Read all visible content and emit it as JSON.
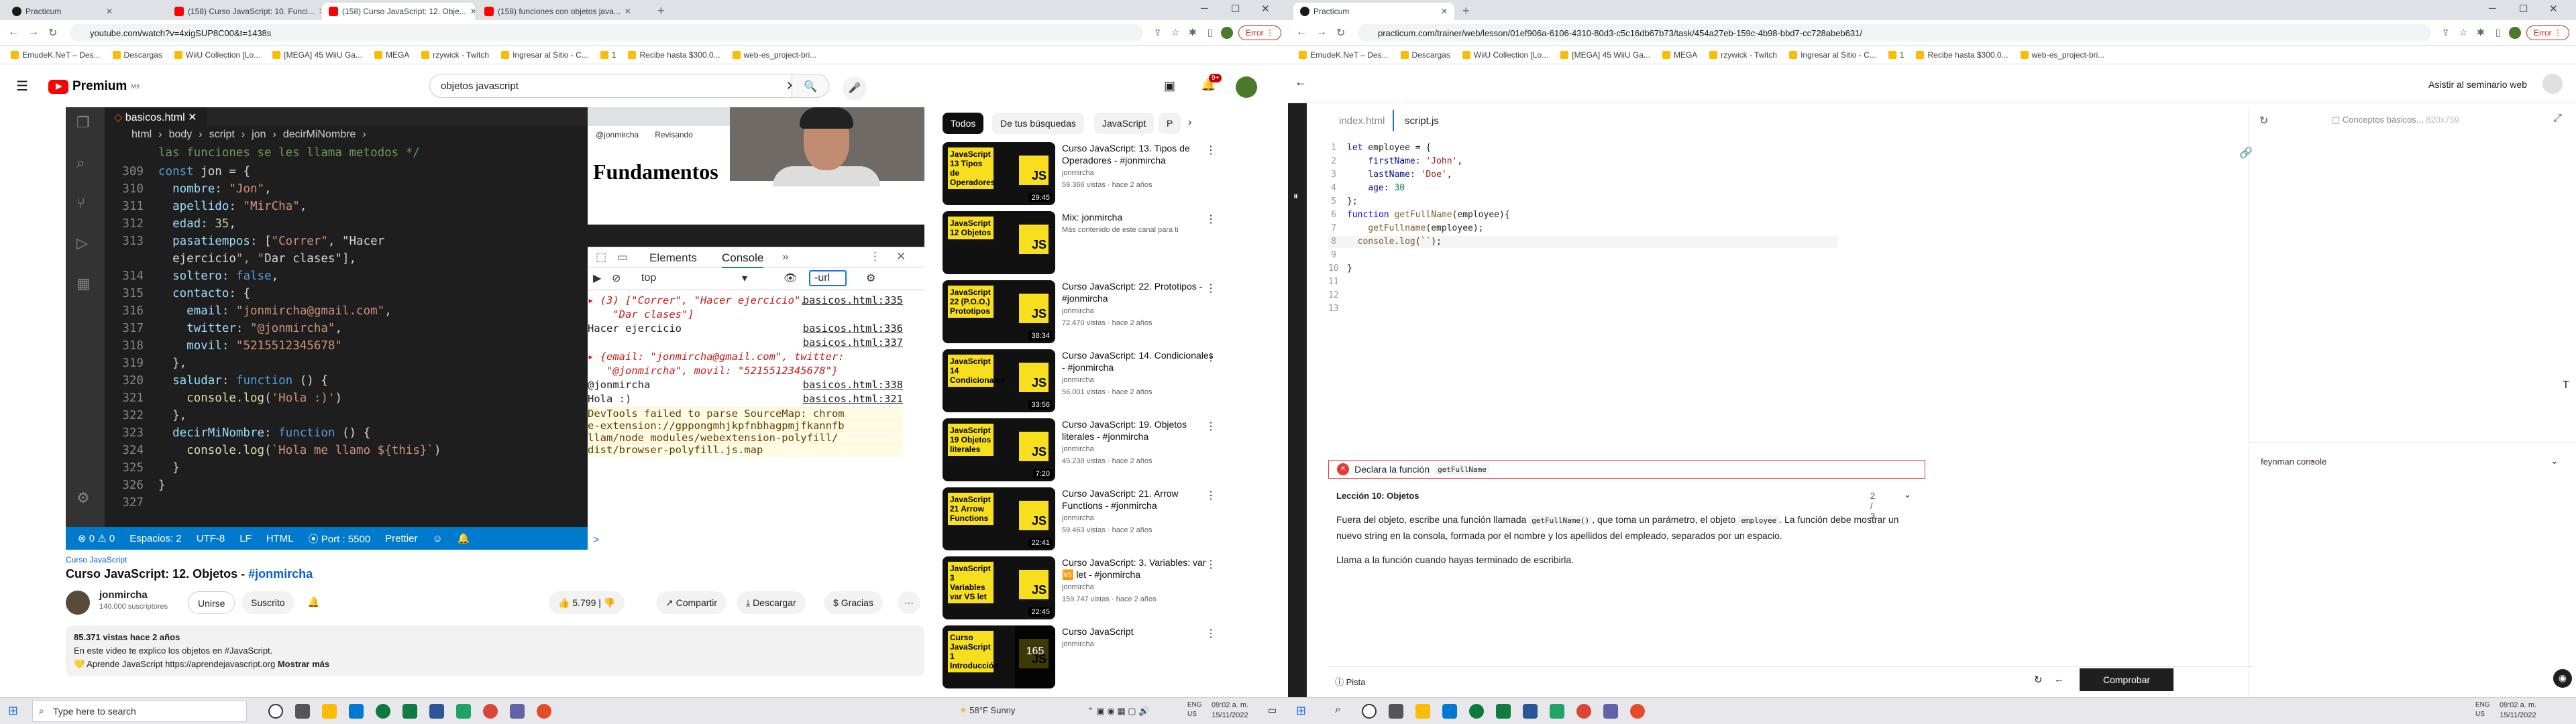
{
  "left_browser": {
    "tabs": [
      {
        "title": "Practicum",
        "active": false
      },
      {
        "title": "(158) Curso JavaScript: 10. Funci...",
        "active": false
      },
      {
        "title": "(158) Curso JavaScript: 12. Obje...",
        "active": true
      },
      {
        "title": "(158) funciones con objetos java...",
        "active": false
      }
    ],
    "url": "youtube.com/watch?v=4xigSUP8C00&t=1438s",
    "error_label": "Error",
    "bookmarks": [
      "EmudeK.NeT – Des...",
      "Descargas",
      "WiiU Collection [Lo...",
      "[MEGA] 45 WiiU Ga...",
      "MEGA",
      "rzywick - Twitch",
      "Ingresar al Sitio - C...",
      "1",
      "Recibe hasta $300.0...",
      "web-es_project-bri..."
    ]
  },
  "youtube": {
    "logo": "Premium",
    "logo_country": "MX",
    "search_value": "objetos javascript",
    "notification_count": "9+",
    "video": {
      "vscode": {
        "tab": "basicos.html",
        "breadcrumb": [
          "html",
          "body",
          "script",
          "jon",
          "decirMiNombre"
        ],
        "comment": "las funciones se les llama metodos */",
        "lines": [
          {
            "n": "309",
            "t": "const jon = {"
          },
          {
            "n": "310",
            "t": "  nombre: \"Jon\","
          },
          {
            "n": "311",
            "t": "  apellido: \"MirCha\","
          },
          {
            "n": "312",
            "t": "  edad: 35,"
          },
          {
            "n": "313",
            "t": "  pasatiempos: [\"Correr\", \"Hacer"
          },
          {
            "n": "",
            "t": "  ejercicio\", \"Dar clases\"],"
          },
          {
            "n": "314",
            "t": "  soltero: false,"
          },
          {
            "n": "315",
            "t": "  contacto: {"
          },
          {
            "n": "316",
            "t": "    email: \"jonmircha@gmail.com\","
          },
          {
            "n": "317",
            "t": "    twitter: \"@jonmircha\","
          },
          {
            "n": "318",
            "t": "    movil: \"5215512345678\""
          },
          {
            "n": "319",
            "t": "  },"
          },
          {
            "n": "320",
            "t": "  saludar: function () {"
          },
          {
            "n": "321",
            "t": "    console.log('Hola :)')"
          },
          {
            "n": "322",
            "t": "  },"
          },
          {
            "n": "323",
            "t": "  decirMiNombre: function () {"
          },
          {
            "n": "324",
            "t": "    console.log(`Hola me llamo ${this}`)"
          },
          {
            "n": "325",
            "t": "  }"
          },
          {
            "n": "326",
            "t": "}"
          },
          {
            "n": "327",
            "t": ""
          }
        ],
        "status": [
          "⊗ 0 ⚠ 0",
          "Espacios: 2",
          "UTF-8",
          "LF",
          "HTML",
          "⦿ Port : 5500",
          "Prettier"
        ]
      },
      "page_heading": "Fundamentos",
      "page_bookmarks": [
        "@jonmircha",
        "Revisando"
      ],
      "devtools": {
        "tabs": [
          "Elements",
          "Console"
        ],
        "context": "top",
        "filter": "-url",
        "rows": [
          {
            "text": "▸ (3) [\"Correr\", \"Hacer ejercicio\",",
            "src": "basicos.html:335",
            "style": "arr"
          },
          {
            "text": "    \"Dar clases\"]",
            "src": "",
            "style": "arr"
          },
          {
            "text": "Hacer ejercicio",
            "src": "basicos.html:336",
            "style": "plain"
          },
          {
            "text": "",
            "src": "basicos.html:337",
            "style": "plain"
          },
          {
            "text": "▸ {email: \"jonmircha@gmail.com\", twitter:",
            "src": "",
            "style": "obj"
          },
          {
            "text": "   \"@jonmircha\", movil: \"5215512345678\"}",
            "src": "",
            "style": "obj"
          },
          {
            "text": "@jonmircha",
            "src": "basicos.html:338",
            "style": "plain"
          },
          {
            "text": "Hola :)",
            "src": "basicos.html:321",
            "style": "plain"
          },
          {
            "text": "DevTools failed to parse SourceMap: chrom",
            "src": "",
            "style": "warn"
          },
          {
            "text": "e-extension://gppongmhjkpfnbhagpmjfkannfb",
            "src": "",
            "style": "warn"
          },
          {
            "text": "llam/node_modules/webextension-polyfill/",
            "src": "",
            "style": "warn"
          },
          {
            "text": "dist/browser-polyfill.js.map",
            "src": "",
            "style": "warn"
          }
        ],
        "prompt": ">"
      }
    },
    "channel_link": "Curso JavaScript",
    "title": "Curso JavaScript: 12. Objetos - #jonmircha",
    "channel": {
      "name": "jonmircha",
      "subs": "140.000 suscriptores",
      "join": "Unirse",
      "subscribe": "Suscrito"
    },
    "actions": {
      "likes": "5.799",
      "share": "Compartir",
      "download": "Descargar",
      "thanks": "Gracias"
    },
    "description": {
      "stats": "85.371 vistas  hace 2 años",
      "line1": "En este video te explico los objetos en #JavaScript.",
      "line2": "💛 Aprende JavaScript https://aprendejavascript.org",
      "more": "Mostrar más"
    },
    "chips": [
      "Todos",
      "De tus búsquedas",
      "JavaScript",
      "P"
    ],
    "recommended": [
      {
        "title": "Curso JavaScript: 13. Tipos de Operadores - #jonmircha",
        "channel": "jonmircha",
        "meta": "59.366 vistas · hace 2 años",
        "dur": "29:45",
        "thumb": "JavaScript 13 Tipos de Operadores"
      },
      {
        "title": "Mix: jonmircha",
        "channel": "Más contenido de este canal para ti",
        "meta": "",
        "dur": "",
        "thumb": "JavaScript 12 Objetos"
      },
      {
        "title": "Curso JavaScript: 22. Prototipos - #jonmircha",
        "channel": "jonmircha",
        "meta": "72.470 vistas · hace 2 años",
        "dur": "38:34",
        "thumb": "JavaScript 22 (P.O.O.) Prototipos"
      },
      {
        "title": "Curso JavaScript: 14. Condicionales - #jonmircha",
        "channel": "jonmircha",
        "meta": "56.001 vistas · hace 2 años",
        "dur": "33:56",
        "thumb": "JavaScript 14 Condicionales"
      },
      {
        "title": "Curso JavaScript: 19. Objetos literales - #jonmircha",
        "channel": "jonmircha",
        "meta": "45.238 vistas · hace 2 años",
        "dur": "7:20",
        "thumb": "JavaScript 19 Objetos literales"
      },
      {
        "title": "Curso JavaScript: 21. Arrow Functions - #jonmircha",
        "channel": "jonmircha",
        "meta": "59.463 vistas · hace 2 años",
        "dur": "22:41",
        "thumb": "JavaScript 21 Arrow Functions"
      },
      {
        "title": "Curso JavaScript: 3. Variables: var 🆚 let - #jonmircha",
        "channel": "jonmircha",
        "meta": "159.747 vistas · hace 2 años",
        "dur": "22:45",
        "thumb": "JavaScript 3 Variables var VS let"
      },
      {
        "title": "Curso JavaScript",
        "channel": "jonmircha",
        "meta": "",
        "dur": "",
        "thumb": "Curso JavaScript 1 Introducción",
        "count": "165"
      }
    ]
  },
  "right_browser": {
    "tab": "Practicum",
    "url": "practicum.com/trainer/web/lesson/01ef906a-6106-4310-80d3-c5c16db67b73/task/454a27eb-159c-4b98-bbd7-cc728abeb631/",
    "error_label": "Error",
    "bookmarks": [
      "EmudeK.NeT – Des...",
      "Descargas",
      "WiiU Collection [Lo...",
      "[MEGA] 45 WiiU Ga...",
      "MEGA",
      "rzywick - Twitch",
      "Ingresar al Sitio - C...",
      "1",
      "Recibe hasta $300.0...",
      "web-es_project-bri..."
    ]
  },
  "practicum": {
    "seminar": "Asistir al seminario web",
    "file_tabs": [
      "index.html",
      "script.js"
    ],
    "preview_title": "Conceptos básicos...",
    "preview_size": "820x759",
    "code": [
      {
        "n": "1",
        "t": "let employee = {"
      },
      {
        "n": "2",
        "t": "    firstName: 'John',"
      },
      {
        "n": "3",
        "t": "    lastName: 'Doe',"
      },
      {
        "n": "4",
        "t": "    age: 30"
      },
      {
        "n": "5",
        "t": "};"
      },
      {
        "n": "6",
        "t": "function getFullName(employee){"
      },
      {
        "n": "7",
        "t": "    getFullname(employee);"
      },
      {
        "n": "8",
        "t": "  console.log(``);"
      },
      {
        "n": "9",
        "t": ""
      },
      {
        "n": "10",
        "t": "}"
      },
      {
        "n": "11",
        "t": ""
      },
      {
        "n": "12",
        "t": ""
      },
      {
        "n": "13",
        "t": ""
      }
    ],
    "task_error": "Declara la función",
    "task_error_code": "getFullName",
    "lesson_label": "Lección 10: Objetos",
    "progress": "2 / 3",
    "instructions": {
      "p1_a": "Fuera del objeto, escribe una función llamada",
      "p1_code1": "getFullName()",
      "p1_b": ", que toma un parámetro, el objeto",
      "p1_code2": "employee",
      "p1_c": ". La función debe mostrar un nuevo string en la consola, formada por el nombre y los apellidos del empleado, separados por un espacio.",
      "p2": "Llama a la función cuando hayas terminado de escribirla."
    },
    "hint": "Pista",
    "check": "Comprobar",
    "console_label": "feynman console"
  },
  "taskbar": {
    "search_placeholder": "Type here to search",
    "weather": "58°F  Sunny",
    "lang": "ENG\nUS",
    "time": "09:02 a. m.",
    "date": "15/11/2022"
  }
}
